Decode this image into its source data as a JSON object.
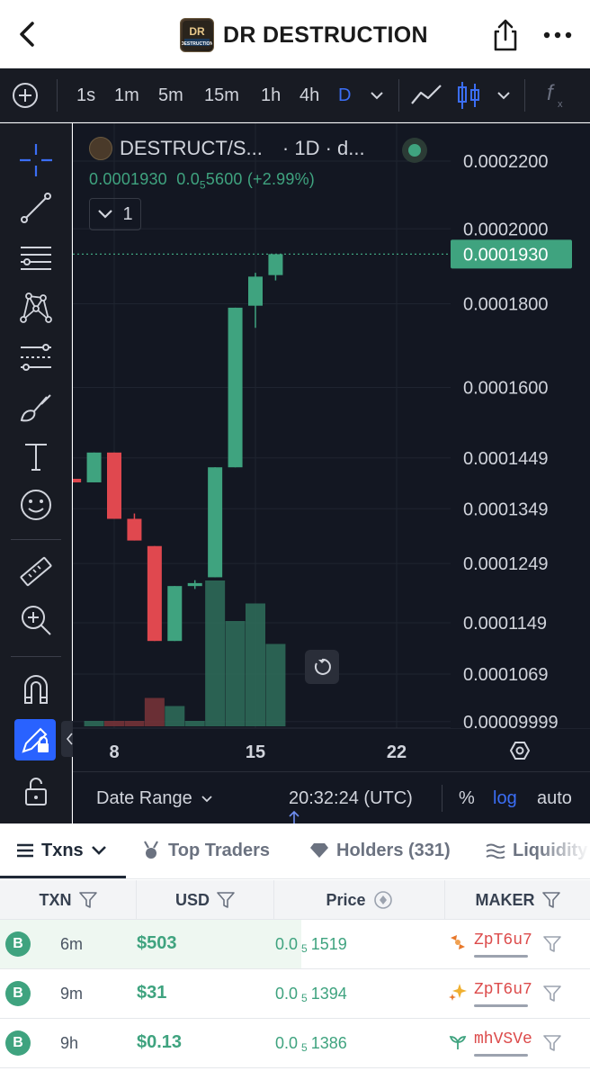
{
  "header": {
    "title": "DR DESTRUCTION",
    "logo_text": "DR DESTRUCTION"
  },
  "toolbar": {
    "intervals": [
      "1s",
      "1m",
      "5m",
      "15m",
      "1h",
      "4h",
      "D"
    ],
    "active_interval": "D",
    "accent": "#3b6ef5"
  },
  "chart": {
    "pair": "DESTRUCT/S...",
    "timeframe": "· 1D · d...",
    "legend_price": "0.0001930",
    "legend_change_prefix": "0.0",
    "legend_change_sub": "5",
    "legend_change_rest": "5600 (+2.99%)",
    "series_toggle": "1",
    "last_price_label": "0.0001930",
    "footer": {
      "date_range": "Date Range",
      "time": "20:32:24 (UTC)",
      "percent": "%",
      "log": "log",
      "auto": "auto"
    }
  },
  "chart_data": {
    "type": "candlestick",
    "scale": "log",
    "y_ticks": [
      "0.0002200",
      "0.0002000",
      "0.0001800",
      "0.0001600",
      "0.0001449",
      "0.0001349",
      "0.0001249",
      "0.0001149",
      "0.0001069",
      "0.00009999"
    ],
    "y_tick_values": [
      0.00022,
      0.0002,
      0.00018,
      0.00016,
      0.0001449,
      0.0001349,
      0.0001249,
      0.0001149,
      0.0001069,
      9.999e-05
    ],
    "x_ticks": [
      "8",
      "15",
      "22"
    ],
    "x_tick_days": [
      8,
      15,
      22
    ],
    "candles": [
      {
        "day": 6,
        "open": 0.0001407,
        "high": 0.0001407,
        "low": 0.00014,
        "close": 0.00014
      },
      {
        "day": 7,
        "open": 0.00014,
        "high": 0.000146,
        "low": 0.00014,
        "close": 0.000146
      },
      {
        "day": 8,
        "open": 0.000146,
        "high": 0.000146,
        "low": 0.000133,
        "close": 0.000133
      },
      {
        "day": 9,
        "open": 0.000133,
        "high": 0.000134,
        "low": 0.000129,
        "close": 0.000129
      },
      {
        "day": 10,
        "open": 0.000128,
        "high": 0.000128,
        "low": 0.000112,
        "close": 0.000112
      },
      {
        "day": 11,
        "open": 0.000112,
        "high": 0.000121,
        "low": 0.000112,
        "close": 0.000121
      },
      {
        "day": 12,
        "open": 0.000121,
        "high": 0.000122,
        "low": 0.0001205,
        "close": 0.0001215
      },
      {
        "day": 13,
        "open": 0.0001225,
        "high": 0.000143,
        "low": 0.0001225,
        "close": 0.000143
      },
      {
        "day": 14,
        "open": 0.000143,
        "high": 0.000179,
        "low": 0.000143,
        "close": 0.000179
      },
      {
        "day": 15,
        "open": 0.0001795,
        "high": 0.000188,
        "low": 0.000174,
        "close": 0.000187
      },
      {
        "day": 16,
        "open": 0.0001874,
        "high": 0.000193,
        "low": 0.000186,
        "close": 0.000193
      }
    ],
    "volume": [
      {
        "day": 7,
        "value": 4,
        "dir": "up"
      },
      {
        "day": 8,
        "value": 4,
        "dir": "down"
      },
      {
        "day": 9,
        "value": 4,
        "dir": "down"
      },
      {
        "day": 10,
        "value": 21,
        "dir": "down"
      },
      {
        "day": 11,
        "value": 15,
        "dir": "up"
      },
      {
        "day": 12,
        "value": 4,
        "dir": "up"
      },
      {
        "day": 13,
        "value": 108,
        "dir": "up"
      },
      {
        "day": 14,
        "value": 78,
        "dir": "up"
      },
      {
        "day": 15,
        "value": 91,
        "dir": "up"
      },
      {
        "day": 16,
        "value": 61,
        "dir": "up"
      }
    ],
    "up_color": "#3fa37f",
    "down_color": "#e0484f"
  },
  "tabs": {
    "txns": "Txns",
    "top_traders": "Top Traders",
    "holders": "Holders (331)",
    "liquidity": "Liquidity"
  },
  "table": {
    "headers": {
      "txn": "TXN",
      "usd": "USD",
      "price": "Price",
      "maker": "MAKER"
    },
    "rows": [
      {
        "type": "B",
        "age": "6m",
        "usd": "$503",
        "price_prefix": "0.0",
        "price_sub": "5",
        "price_rest": "1519",
        "maker": "ZpT6u7",
        "maker_icon": "orange-swap-icon",
        "bar": 0.51
      },
      {
        "type": "B",
        "age": "9m",
        "usd": "$31",
        "price_prefix": "0.0",
        "price_sub": "5",
        "price_rest": "1394",
        "maker": "ZpT6u7",
        "maker_icon": "sparkle-icon",
        "bar": 0
      },
      {
        "type": "B",
        "age": "9h",
        "usd": "$0.13",
        "price_prefix": "0.0",
        "price_sub": "5",
        "price_rest": "1386",
        "maker": "mhVSVe",
        "maker_icon": "plant-icon",
        "bar": 0
      }
    ]
  }
}
